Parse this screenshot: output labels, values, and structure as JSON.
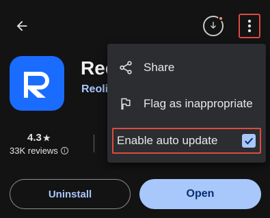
{
  "toolbar": {
    "back_icon": "arrow-back-icon",
    "download_icon": "download-icon",
    "more_icon": "more-vert-icon"
  },
  "app": {
    "name": "Reo",
    "developer": "Reolin",
    "icon_color": "#1a6cff"
  },
  "stats": {
    "rating": "4.3",
    "star": "★",
    "reviews": "33K reviews",
    "info_icon": "i"
  },
  "actions": {
    "uninstall_label": "Uninstall",
    "open_label": "Open"
  },
  "menu": {
    "items": [
      {
        "label": "Share",
        "icon": "share-icon"
      },
      {
        "label": "Flag as inappropriate",
        "icon": "flag-icon"
      },
      {
        "label": "Enable auto update",
        "checked": true
      }
    ]
  },
  "colors": {
    "background": "#131314",
    "accent": "#a8c7fa",
    "menu_background": "#2b2d30",
    "highlight_border": "#e04a3f"
  }
}
